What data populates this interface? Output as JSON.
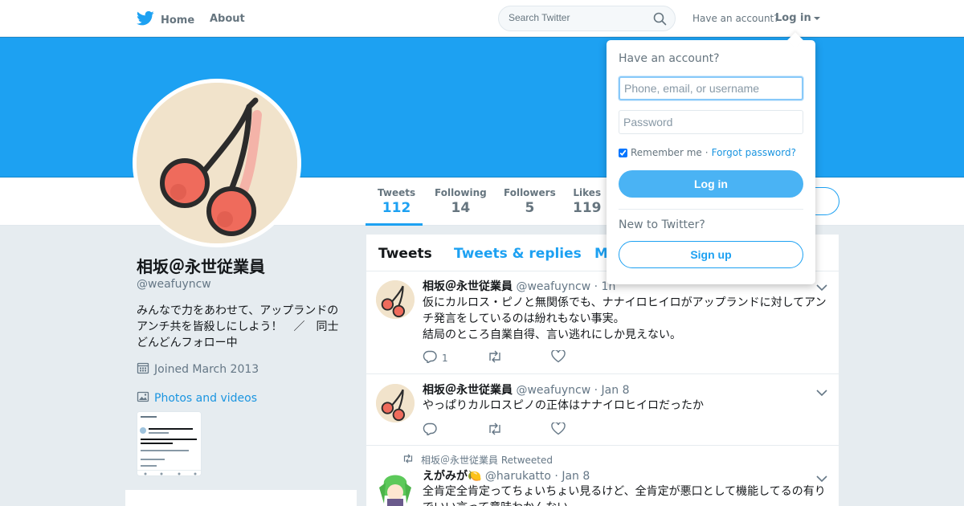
{
  "nav": {
    "home_label": "Home",
    "about_label": "About",
    "search_placeholder": "Search Twitter",
    "have_account": "Have an account?",
    "login_label": "Log in"
  },
  "colors": {
    "brand": "#1da1f2",
    "banner": "#1da1f2",
    "link": "#1b95e0"
  },
  "profile": {
    "name": "相坂＠永世従業員",
    "handle": "@weafuyncw",
    "bio": "みんなで力をあわせて、アップランドの\nアンチ共を皆殺しにしよう！　／　同士\nどんどんフォロー中",
    "joined": "Joined March 2013",
    "photos_label": "Photos and videos"
  },
  "stats": [
    {
      "label": "Tweets",
      "value": "112"
    },
    {
      "label": "Following",
      "value": "14"
    },
    {
      "label": "Followers",
      "value": "5"
    },
    {
      "label": "Likes",
      "value": "119"
    }
  ],
  "timeline_tabs": [
    "Tweets",
    "Tweets & replies",
    "M"
  ],
  "tweets": [
    {
      "name": "相坂＠永世従業員",
      "handle": "@weafuyncw",
      "date": "· 1h",
      "text": "仮にカルロス・ピノと無関係でも、ナナイロヒイロがアップランドに対してアン\nチ発言をしているのは紛れもない事実。\n結局のところ自業自得、言い逃れにしか見えない。",
      "reply_count": "1"
    },
    {
      "name": "相坂＠永世従業員",
      "handle": "@weafuyncw",
      "date": "· Jan 8",
      "text": "やっぱりカルロスピノの正体はナナイロヒイロだったか",
      "reply_count": ""
    },
    {
      "retweeted_by": "相坂＠永世従業員 Retweeted",
      "name": "えがみが🍋",
      "handle": "@harukatto",
      "date": "· Jan 8",
      "text": "全肯定全肯定ってちょいちょい見るけど、全肯定が悪口として機能してるの有り\nでいい言って意味わかんない"
    }
  ],
  "login": {
    "title": "Have an account?",
    "username_placeholder": "Phone, email, or username",
    "password_placeholder": "Password",
    "remember_label": "Remember me",
    "separator": "·",
    "forgot_label": "Forgot password?",
    "login_button": "Log in",
    "new_prompt": "New to Twitter?",
    "signup_button": "Sign up"
  },
  "icons": [
    "twitter-bird-icon",
    "search-icon",
    "caret-down-icon",
    "calendar-icon",
    "image-icon",
    "reply-icon",
    "retweet-icon",
    "heart-icon",
    "chevron-down-icon"
  ]
}
